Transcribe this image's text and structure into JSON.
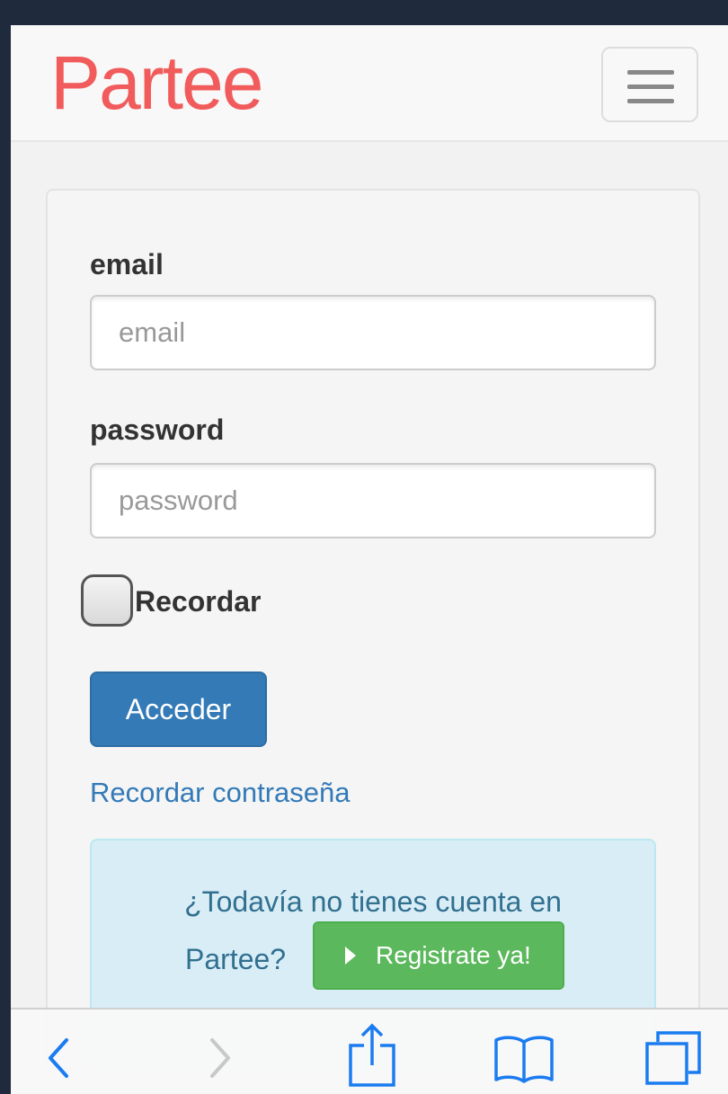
{
  "navbar": {
    "brand": "Partee",
    "menu_icon": "hamburger-menu-icon"
  },
  "form": {
    "email_label": "email",
    "email_placeholder": "email",
    "email_value": "",
    "password_label": "password",
    "password_placeholder": "password",
    "password_value": "",
    "remember_label": "Recordar",
    "remember_checked": false,
    "submit_label": "Acceder",
    "forgot_link": "Recordar contraseña"
  },
  "signup": {
    "line1": "¿Todavía no tienes cuenta en",
    "line2": "Partee?",
    "button_label": "Registrate ya!",
    "button_icon": "play-triangle-icon"
  },
  "browser_toolbar": {
    "icons": [
      "back-chevron-icon",
      "forward-chevron-icon",
      "share-icon",
      "bookmarks-icon",
      "tabs-icon"
    ]
  },
  "colors": {
    "brand": "#f15b5b",
    "primary": "#337ab7",
    "success": "#5cb85c",
    "info_bg": "#d9edf7",
    "info_text": "#31708f",
    "ios_blue": "#1a7cf0",
    "frame": "#1f2a3c"
  }
}
